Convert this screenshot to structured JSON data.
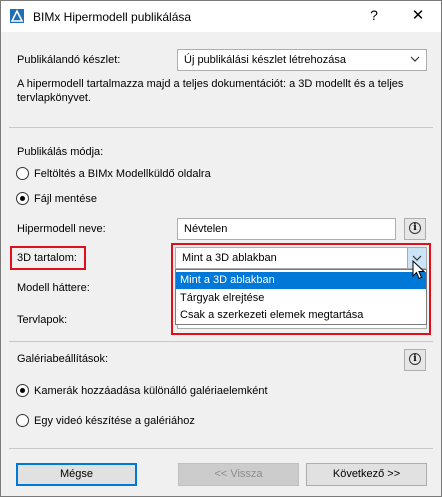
{
  "window": {
    "title": "BIMx Hipermodell publikálása",
    "help_glyph": "?",
    "close_glyph": "✕"
  },
  "publish_set": {
    "label": "Publikálandó készlet:",
    "value": "Új publikálási készlet létrehozása"
  },
  "description": {
    "line1": "A hipermodell tartalmazza majd a teljes dokumentációt: a 3D modellt és a teljes",
    "line2": "tervlapkönyvet."
  },
  "publish_mode": {
    "label": "Publikálás módja:",
    "options": [
      {
        "label": "Feltöltés a BIMx Modellküldő oldalra",
        "selected": false
      },
      {
        "label": "Fájl mentése",
        "selected": true
      }
    ]
  },
  "hypermodel_name": {
    "label": "Hipermodell neve:",
    "value": "Névtelen"
  },
  "content_3d": {
    "label": "3D tartalom:",
    "value": "Mint a 3D ablakban",
    "options": [
      "Mint a 3D ablakban",
      "Tárgyak elrejtése",
      "Csak a szerkezeti elemek megtartása"
    ],
    "selected_index": 0
  },
  "model_background": {
    "label": "Modell háttere:"
  },
  "layouts": {
    "label": "Tervlapok:"
  },
  "gallery": {
    "label": "Galériabeállítások:",
    "options": [
      {
        "label": "Kamerák hozzáadása különálló galériaelemként",
        "selected": true
      },
      {
        "label": "Egy videó készítése a galériához",
        "selected": false
      }
    ]
  },
  "buttons": {
    "cancel": "Mégse",
    "back": "<< Vissza",
    "next": "Következő >>"
  },
  "colors": {
    "highlight_red": "#e0101a",
    "selection_blue": "#0078d7"
  },
  "icons": {
    "app": "archicad-logo-icon",
    "info": "info-icon",
    "chevron": "chevron-down-icon",
    "cursor": "mouse-cursor-icon"
  }
}
